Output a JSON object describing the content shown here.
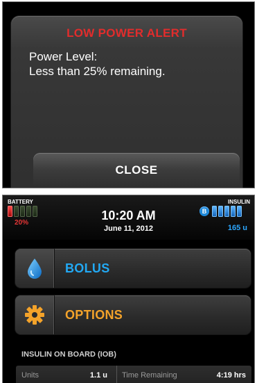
{
  "alert": {
    "title": "LOW POWER ALERT",
    "message_line1": "Power Level:",
    "message_line2": "Less than 25% remaining.",
    "close_label": "CLOSE",
    "title_color": "#e22c2c"
  },
  "status": {
    "battery_label": "BATTERY",
    "battery_percent_text": "20%",
    "battery_level": 0.2,
    "battery_color": "#e73636",
    "time": "10:20 AM",
    "date": "June 11, 2012",
    "insulin_label": "INSULIN",
    "insulin_badge": "B",
    "insulin_units": "165 u",
    "insulin_color": "#2da8ff"
  },
  "menu": {
    "bolus_label": "BOLUS",
    "bolus_icon": "water-drop-icon",
    "bolus_color": "#22a9f4",
    "options_label": "OPTIONS",
    "options_icon": "gear-icon",
    "options_color": "#f4a32a"
  },
  "iob": {
    "title": "INSULIN ON BOARD (IOB)",
    "units_label": "Units",
    "units_value": "1.1 u",
    "time_label": "Time Remaining",
    "time_value": "4:19 hrs"
  }
}
